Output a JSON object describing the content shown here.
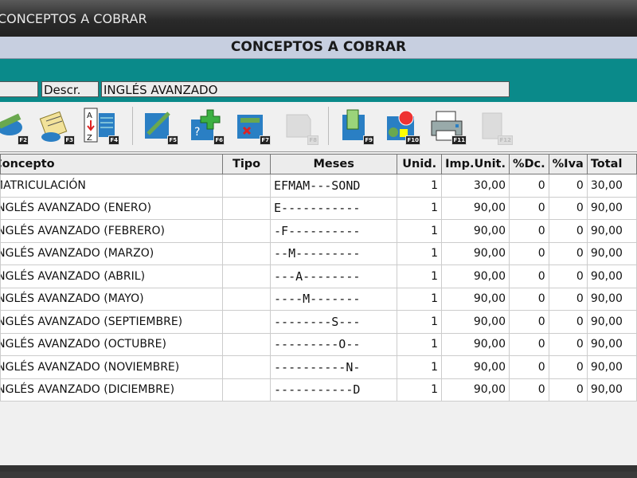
{
  "window": {
    "title": "CONCEPTOS A COBRAR"
  },
  "header": {
    "title": "CONCEPTOS A COBRAR"
  },
  "filter": {
    "descr_label": "Descr.",
    "descr_value": "INGLÉS AVANZADO"
  },
  "toolbar": {
    "buttons": [
      {
        "key": "F2",
        "icon": "edit-tools-icon"
      },
      {
        "key": "F3",
        "icon": "note-scroll-icon"
      },
      {
        "key": "F4",
        "icon": "sort-az-icon"
      },
      {
        "key": "F5",
        "icon": "edit-pen-icon"
      },
      {
        "key": "F6",
        "icon": "add-plus-icon"
      },
      {
        "key": "F7",
        "icon": "delete-red-icon"
      },
      {
        "key": "F8",
        "icon": "disabled-icon"
      },
      {
        "key": "F9",
        "icon": "attachment-icon"
      },
      {
        "key": "F10",
        "icon": "chart-icon"
      },
      {
        "key": "F11",
        "icon": "printer-icon"
      },
      {
        "key": "F12",
        "icon": "disabled-icon"
      }
    ]
  },
  "table": {
    "columns": [
      "Concepto",
      "Tipo",
      "Meses",
      "Unid.",
      "Imp.Unit.",
      "%Dc.",
      "%Iva",
      "Total"
    ],
    "rows": [
      [
        "MATRICULACIÓN",
        "",
        "EFMAM---SOND",
        "1",
        "30,00",
        "0",
        "0",
        "30,00"
      ],
      [
        "INGLÉS AVANZADO (ENERO)",
        "",
        "E-----------",
        "1",
        "90,00",
        "0",
        "0",
        "90,00"
      ],
      [
        "INGLÉS AVANZADO (FEBRERO)",
        "",
        "-F----------",
        "1",
        "90,00",
        "0",
        "0",
        "90,00"
      ],
      [
        "INGLÉS AVANZADO (MARZO)",
        "",
        "--M---------",
        "1",
        "90,00",
        "0",
        "0",
        "90,00"
      ],
      [
        "INGLÉS AVANZADO (ABRIL)",
        "",
        "---A--------",
        "1",
        "90,00",
        "0",
        "0",
        "90,00"
      ],
      [
        "INGLÉS AVANZADO (MAYO)",
        "",
        "----M-------",
        "1",
        "90,00",
        "0",
        "0",
        "90,00"
      ],
      [
        "INGLÉS AVANZADO (SEPTIEMBRE)",
        "",
        "--------S---",
        "1",
        "90,00",
        "0",
        "0",
        "90,00"
      ],
      [
        "INGLÉS AVANZADO (OCTUBRE)",
        "",
        "---------O--",
        "1",
        "90,00",
        "0",
        "0",
        "90,00"
      ],
      [
        "INGLÉS AVANZADO (NOVIEMBRE)",
        "",
        "----------N-",
        "1",
        "90,00",
        "0",
        "0",
        "90,00"
      ],
      [
        "INGLÉS AVANZADO (DICIEMBRE)",
        "",
        "-----------D",
        "1",
        "90,00",
        "0",
        "0",
        "90,00"
      ]
    ]
  }
}
